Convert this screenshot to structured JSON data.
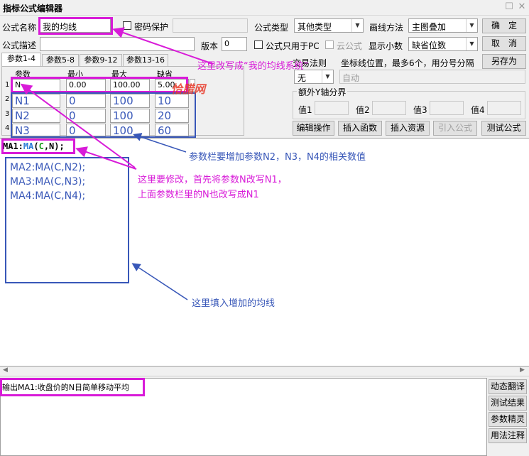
{
  "window": {
    "title": "指标公式编辑器"
  },
  "form": {
    "name_label": "公式名称",
    "name_value": "我的均线",
    "password_label": "密码保护",
    "type_label": "公式类型",
    "type_value": "其他类型",
    "draw_label": "画线方法",
    "draw_value": "主图叠加",
    "desc_label": "公式描述",
    "version_label": "版本",
    "version_value": "0",
    "pc_only_label": "公式只用于PC",
    "cloud_label": "云公式",
    "decimals_label": "显示小数",
    "decimals_value": "缺省位数",
    "trade_rule_label": "交易法则",
    "trade_rule_value": "无",
    "coord_label": "坐标线位置，最多6个，用分号分隔",
    "coord_value": "自动",
    "extra_y_label": "额外Y轴分界",
    "y_labels": [
      "值1",
      "值2",
      "值3",
      "值4"
    ]
  },
  "buttons": {
    "ok": "确　定",
    "cancel": "取　消",
    "save_as": "另存为",
    "edit_op": "编辑操作",
    "insert_func": "插入函数",
    "insert_res": "插入资源",
    "import_formula": "引入公式",
    "test_formula": "测试公式",
    "dyn_translate": "动态翻译",
    "test_result": "测试结果",
    "param_tune": "参数精灵",
    "usage_note": "用法注释"
  },
  "tabs": [
    "参数1-4",
    "参数5-8",
    "参数9-12",
    "参数13-16"
  ],
  "params": {
    "headers": [
      "参数",
      "最小",
      "最大",
      "缺省"
    ],
    "rows": [
      {
        "idx": "1",
        "name": "N",
        "min": "0.00",
        "max": "100.00",
        "def": "5.00"
      },
      {
        "idx": "2",
        "name": "N1",
        "min": "0",
        "max": "100",
        "def": "10"
      },
      {
        "idx": "3",
        "name": "N2",
        "min": "0",
        "max": "100",
        "def": "20"
      },
      {
        "idx": "4",
        "name": "N3",
        "min": "0",
        "max": "100",
        "def": "60"
      }
    ]
  },
  "editor": {
    "line1_name": "MA1:",
    "line1_func": "MA",
    "line1_open": "(",
    "line1_arg": "C",
    "line1_rest": ",N);",
    "added_lines": [
      "MA2:MA(C,N2);",
      "MA3:MA(C,N3);",
      "MA4:MA(C,N4);"
    ]
  },
  "output": {
    "text": "输出MA1:收盘价的N日简单移动平均"
  },
  "annotations": {
    "name_note": "这里改写成“我的均线系统”",
    "watermark": "恰腊网",
    "param_note": "参数栏要增加参数N2，N3，N4的相关数值",
    "modify_note_1": "这里要修改，首先将参数N改写N1，",
    "modify_note_2": "上面参数栏里的N也改写成N1",
    "fill_note": "这里填入增加的均线"
  },
  "colors": {
    "pink": "#d81bd8",
    "blue": "#3857b8",
    "func_blue": "#2b7bd6",
    "arg_green": "#1a9c1a"
  }
}
